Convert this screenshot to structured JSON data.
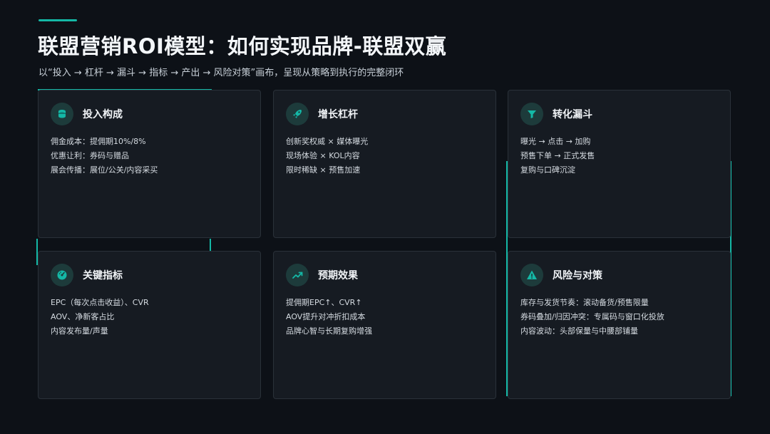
{
  "header": {
    "title": "联盟营销ROI模型：如何实现品牌-联盟双赢",
    "subtitle": "以“投入 → 杠杆 → 漏斗 → 指标 → 产出 → 风险对策”画布，呈现从策略到执行的完整闭环"
  },
  "colors": {
    "accent": "#14b8a6",
    "background": "#0d1117",
    "card": "#161b22"
  },
  "cards": [
    {
      "title": "投入构成",
      "icon": "coins-icon",
      "lines": [
        "佣金成本：提佣期10%/8%",
        "优惠让利：券码与赠品",
        "展会传播：展位/公关/内容采买"
      ]
    },
    {
      "title": "增长杠杆",
      "icon": "rocket-icon",
      "lines": [
        "创新奖权威 × 媒体曝光",
        "现场体验 × KOL内容",
        "限时稀缺 × 预售加速"
      ]
    },
    {
      "title": "转化漏斗",
      "icon": "funnel-icon",
      "lines": [
        "曝光 → 点击 → 加购",
        "预售下单 → 正式发售",
        "复购与口碑沉淀"
      ]
    },
    {
      "title": "关键指标",
      "icon": "gauge-icon",
      "lines": [
        "EPC（每次点击收益）、CVR",
        "AOV、净新客占比",
        "内容发布量/声量"
      ]
    },
    {
      "title": "预期效果",
      "icon": "trend-up-icon",
      "lines": [
        "提佣期EPC↑、CVR↑",
        "AOV提升对冲折扣成本",
        "品牌心智与长期复购增强"
      ]
    },
    {
      "title": "风险与对策",
      "icon": "warning-icon",
      "lines": [
        "库存与发货节奏：滚动备货/预售限量",
        "券码叠加/归因冲突：专属码与窗口化投放",
        "内容波动：头部保量与中腰部铺量"
      ]
    }
  ]
}
